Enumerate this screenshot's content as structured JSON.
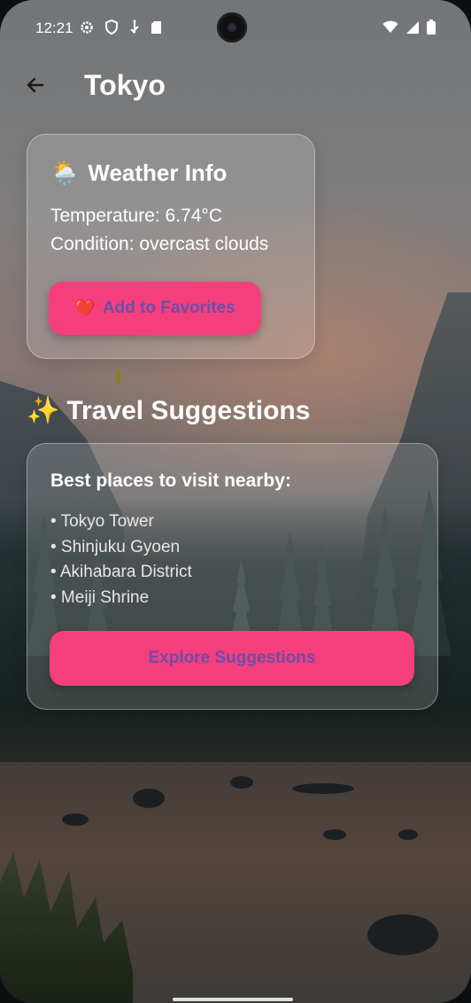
{
  "status_bar": {
    "time": "12:21",
    "left_icons": [
      "gear-icon",
      "shield-icon",
      "usb-icon",
      "sd-card-icon"
    ],
    "right_icons": [
      "wifi-icon",
      "signal-icon",
      "battery-icon"
    ]
  },
  "app_bar": {
    "title": "Tokyo",
    "back_icon": "arrow-back-icon"
  },
  "weather_card": {
    "icon": "🌦️",
    "title": "Weather Info",
    "temperature": "Temperature: 6.74°C",
    "condition": "Condition: overcast clouds",
    "favorite_icon": "❤️",
    "favorite_button": "Add to Favorites"
  },
  "suggestions": {
    "icon": "✨",
    "heading": "Travel Suggestions",
    "card_heading": "Best places to visit nearby:",
    "places": [
      "• Tokyo Tower",
      "• Shinjuku Gyoen",
      "• Akihabara District",
      "• Meiji Shrine"
    ],
    "explore_button": "Explore Suggestions"
  },
  "colors": {
    "accent": "#f53f7d",
    "button_text": "#6b4ea6",
    "text": "#ffffff"
  }
}
